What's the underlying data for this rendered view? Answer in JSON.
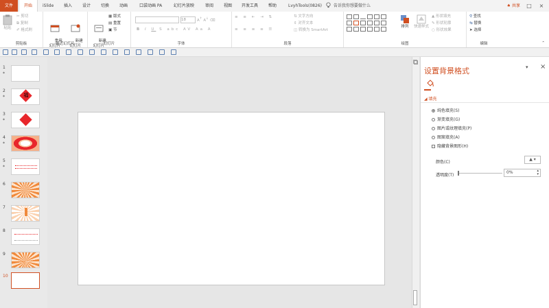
{
  "tabs": [
    "文件",
    "开始",
    "iSlide",
    "插入",
    "设计",
    "切换",
    "动画",
    "口袋动画 PA",
    "幻灯片放映",
    "审阅",
    "视图",
    "开发工具",
    "帮助",
    "LvyhTools(0826)"
  ],
  "search_placeholder": "告诉我你想要做什么",
  "share_label": "共享",
  "window_controls": [
    "restore-icon",
    "close-icon"
  ],
  "ribbon": {
    "clipboard": {
      "group": "剪贴板",
      "paste": "粘贴",
      "cut": "剪切",
      "copy": "复制",
      "format_painter": "格式刷"
    },
    "slides_recent": {
      "group": "最近幻灯片",
      "reuse": "重用\n幻灯片",
      "new_slide": "新建\n幻灯片"
    },
    "slides": {
      "group": "幻灯片",
      "new_slide": "新建\n幻灯片",
      "layout": "版式",
      "reset": "重置",
      "section": "节"
    },
    "font": {
      "group": "字体",
      "font_name": "",
      "font_size": "18"
    },
    "paragraph": {
      "group": "段落",
      "text_direction": "文字方向",
      "align_text": "对齐文本",
      "smartart": "转换为 SmartArt"
    },
    "drawing": {
      "group": "绘图",
      "arrange": "排列",
      "quick_styles": "快速样式",
      "shape_fill": "形状填充",
      "shape_outline": "形状轮廓",
      "shape_effects": "形状效果"
    },
    "editing": {
      "group": "编辑",
      "find": "查找",
      "replace": "替换",
      "select": "选择"
    }
  },
  "thumbnails": [
    {
      "num": "1",
      "star": "*"
    },
    {
      "num": "2",
      "star": "*"
    },
    {
      "num": "3",
      "star": "*"
    },
    {
      "num": "4",
      "star": "*"
    },
    {
      "num": "5",
      "star": "*"
    },
    {
      "num": "6",
      "star": ""
    },
    {
      "num": "7",
      "star": ""
    },
    {
      "num": "8",
      "star": ""
    },
    {
      "num": "9",
      "star": ""
    },
    {
      "num": "10",
      "star": ""
    }
  ],
  "thumb2_char": "福",
  "pane": {
    "title": "设置背景格式",
    "section": "填充",
    "options": [
      "纯色填充(S)",
      "渐变填充(G)",
      "图片或纹理填充(P)",
      "图案填充(A)"
    ],
    "hide_bg_label": "隐藏背景图形(H)",
    "color_label": "颜色(C)",
    "transparency_label": "透明度(T)",
    "transparency_value": "0%"
  },
  "colors": {
    "accent": "#d04f21",
    "red": "#e8262b",
    "orange": "#f08a3c"
  }
}
